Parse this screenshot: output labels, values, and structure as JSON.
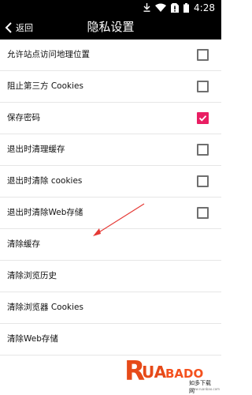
{
  "status_bar": {
    "time": "4:28",
    "icons": [
      "download-arrow-icon",
      "wifi-icon",
      "no-sim-icon",
      "battery-icon"
    ]
  },
  "app_bar": {
    "back_label": "返回",
    "title": "隐私设置"
  },
  "settings": [
    {
      "label": "允许站点访问地理位置",
      "has_checkbox": true,
      "checked": false
    },
    {
      "label": "阻止第三方 Cookies",
      "has_checkbox": true,
      "checked": false
    },
    {
      "label": "保存密码",
      "has_checkbox": true,
      "checked": true
    },
    {
      "label": "退出时清理缓存",
      "has_checkbox": true,
      "checked": false
    },
    {
      "label": "退出时清除 cookies",
      "has_checkbox": true,
      "checked": false
    },
    {
      "label": "退出时清除Web存储",
      "has_checkbox": true,
      "checked": false
    },
    {
      "label": "清除缓存",
      "has_checkbox": false
    },
    {
      "label": "清除浏览历史",
      "has_checkbox": false
    },
    {
      "label": "清除浏览器 Cookies",
      "has_checkbox": false
    },
    {
      "label": "清除Web存储",
      "has_checkbox": false
    }
  ],
  "watermark": {
    "brand": "RUANBADAO",
    "tagline": "如多下载网",
    "url": "www.ruanbao.com"
  },
  "colors": {
    "bar": "#000000",
    "accent": "#e91e63",
    "annotation_arrow": "#e53935"
  }
}
